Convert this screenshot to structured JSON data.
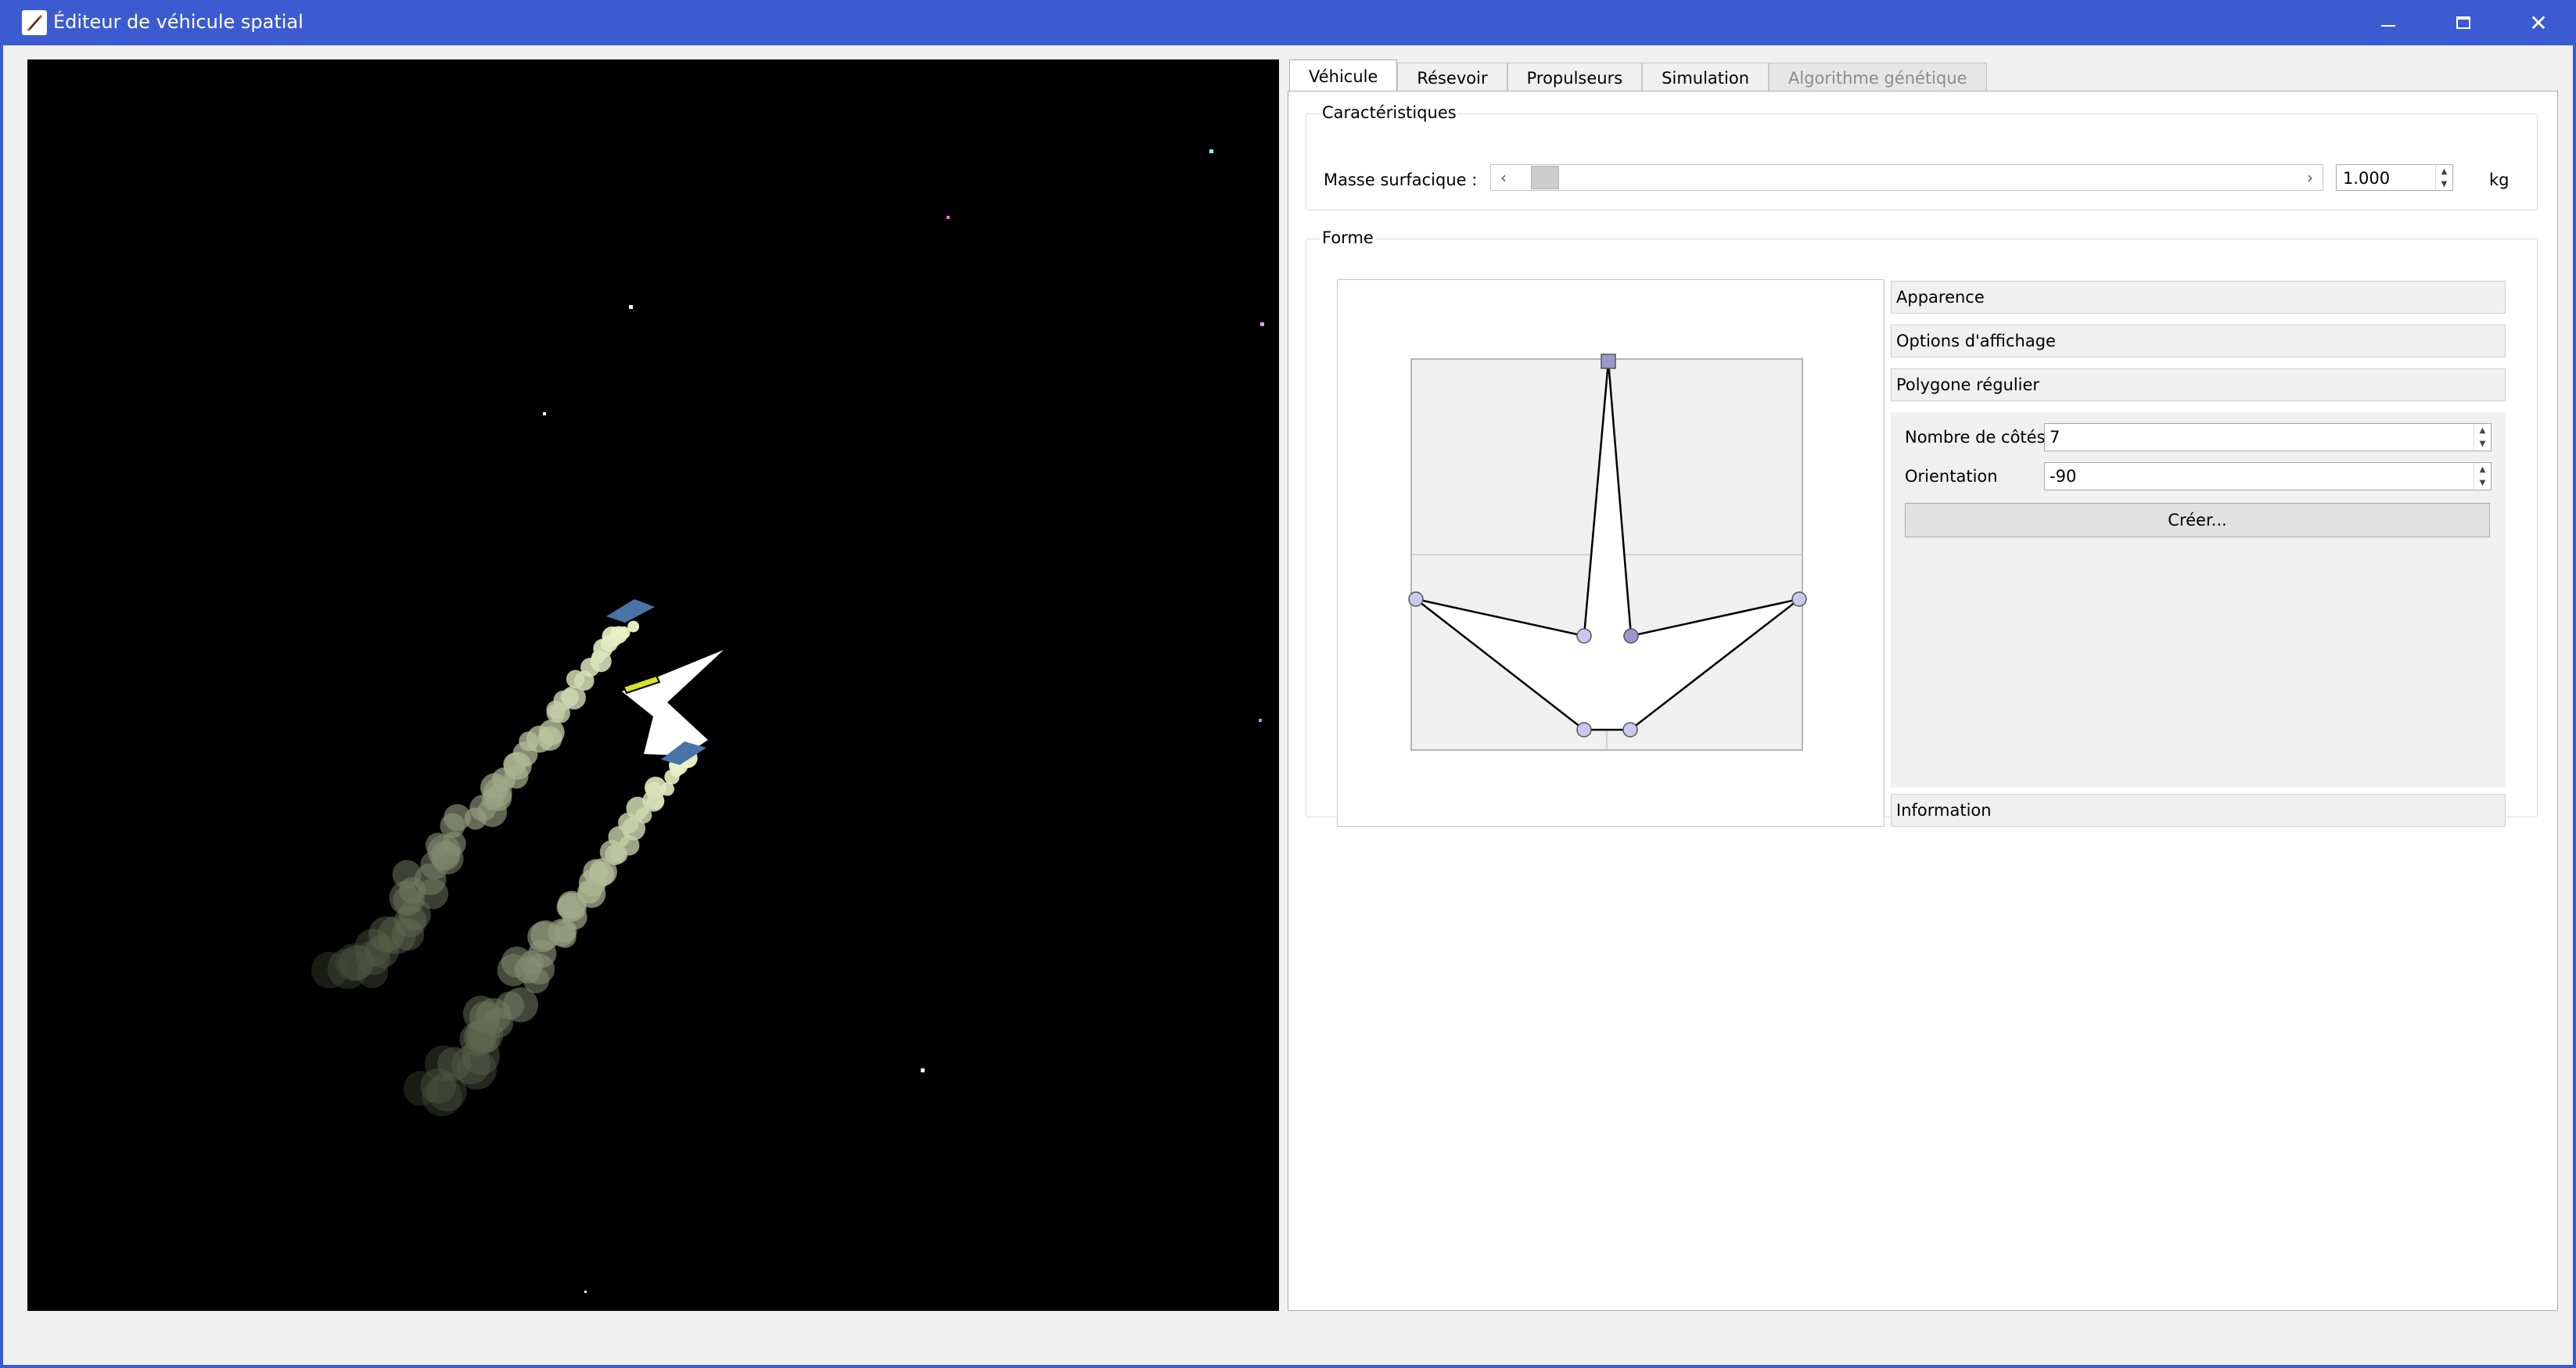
{
  "window": {
    "title": "Éditeur de véhicule spatial"
  },
  "tabs": [
    {
      "label": "Véhicule",
      "active": true,
      "enabled": true
    },
    {
      "label": "Résevoir",
      "active": false,
      "enabled": true
    },
    {
      "label": "Propulseurs",
      "active": false,
      "enabled": true
    },
    {
      "label": "Simulation",
      "active": false,
      "enabled": true
    },
    {
      "label": "Algorithme génétique",
      "active": false,
      "enabled": false
    }
  ],
  "caracteristiques": {
    "title": "Caractéristiques",
    "masse_label": "Masse surfacique :",
    "masse_value": "1.000",
    "unit": "kg",
    "slider_position": 0.02
  },
  "forme": {
    "title": "Forme",
    "sections": {
      "apparence": "Apparence",
      "options": "Options d'affichage",
      "polygone": "Polygone régulier",
      "information": "Information"
    },
    "polygone": {
      "cotes_label": "Nombre de côtés",
      "cotes_value": "7",
      "orientation_label": "Orientation",
      "orientation_value": "-90",
      "create_button": "Créer..."
    }
  },
  "colors": {
    "titlebar": "#3c5bd0",
    "space": "#000000",
    "ship": "#ffffff",
    "thruster": "#4a73a8",
    "tank": "#d8e030",
    "exhaust": "#f2f7d0",
    "vertex": "#c8c8f0",
    "vertex_selected": "#9a98c8"
  },
  "icons": {
    "app": "rocket-feather-icon",
    "minimize": "minimize-icon",
    "maximize": "maximize-icon",
    "close": "close-icon"
  }
}
